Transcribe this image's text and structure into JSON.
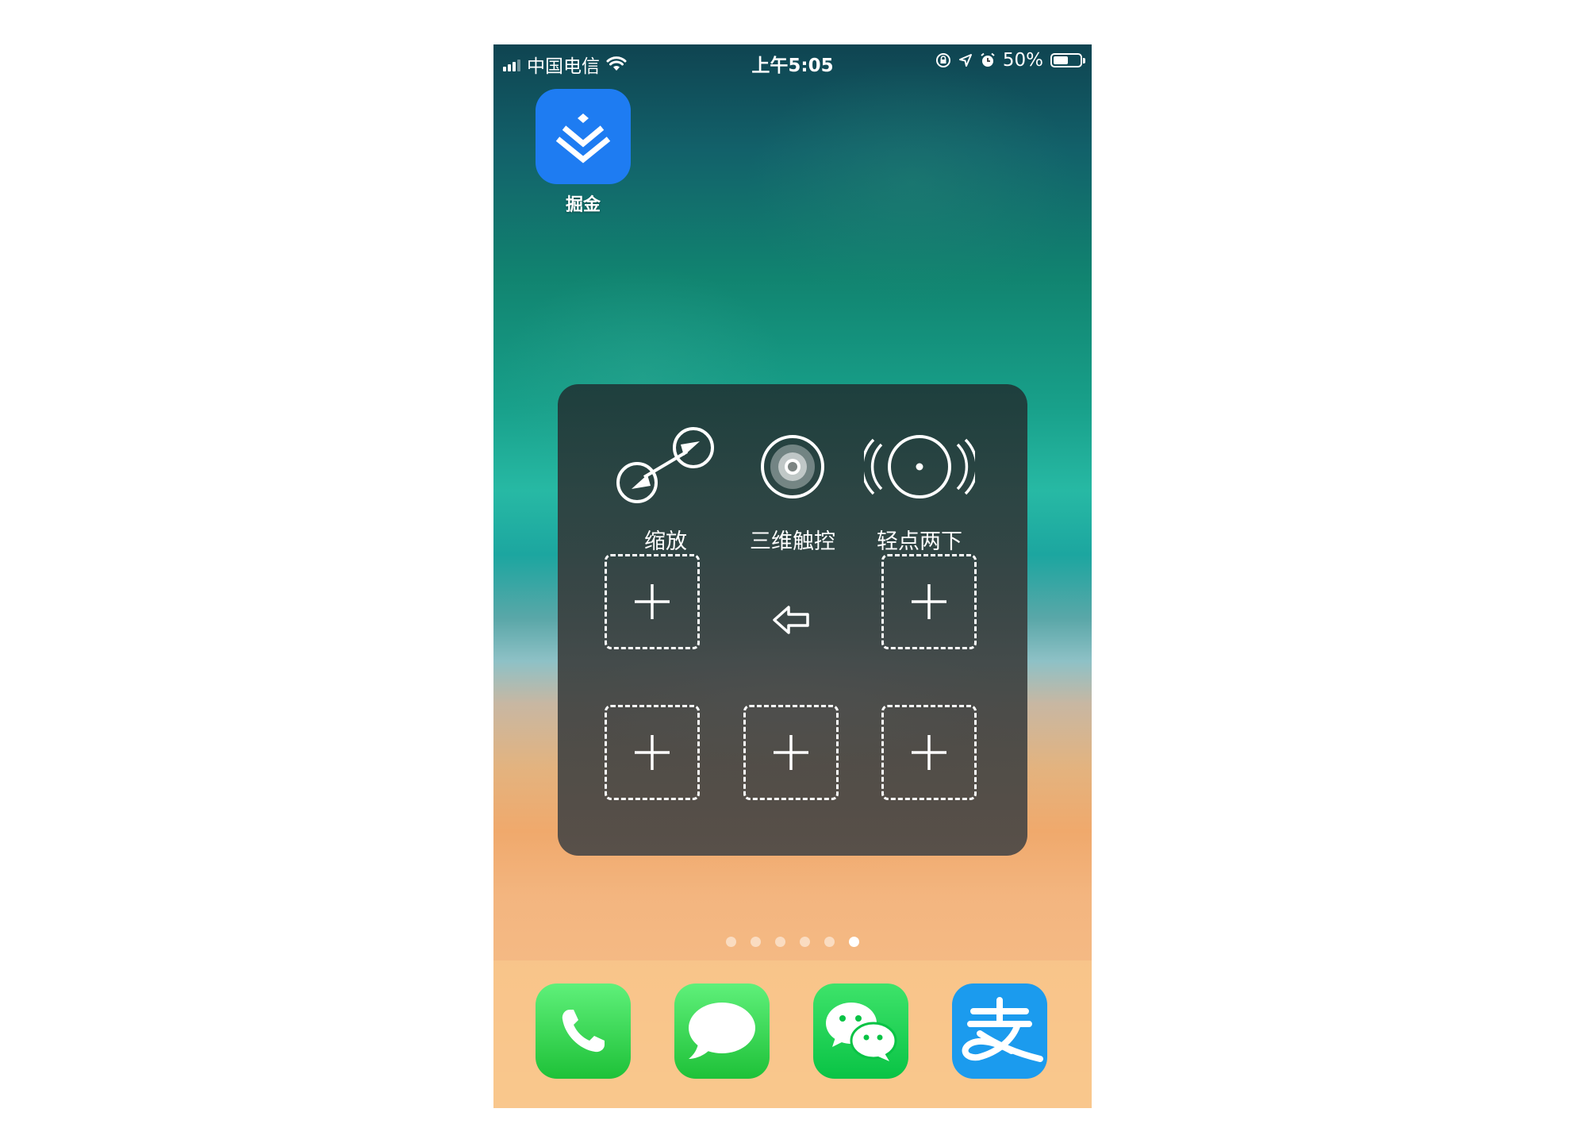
{
  "status_bar": {
    "carrier": "中国电信",
    "time": "上午5:05",
    "battery": "50%",
    "battery_level": 0.5
  },
  "home_apps": [
    {
      "label": "掘金",
      "icon": "juejin-icon"
    }
  ],
  "assistive_touch": {
    "items": [
      {
        "label": "缩放",
        "icon": "pinch-zoom-icon"
      },
      {
        "label": "三维触控",
        "icon": "3d-touch-icon"
      },
      {
        "label": "轻点两下",
        "icon": "double-tap-icon"
      }
    ],
    "empty_slot_icon": "plus-icon",
    "back_icon": "back-arrow-icon"
  },
  "page_dots": {
    "count": 6,
    "active_index": 5
  },
  "dock": [
    {
      "name": "Phone",
      "icon": "phone-icon",
      "color": "#2bd04a"
    },
    {
      "name": "Messages",
      "icon": "message-bubble-icon",
      "color": "#2bd04a"
    },
    {
      "name": "WeChat",
      "icon": "wechat-icon",
      "color": "#09c345"
    },
    {
      "name": "Alipay",
      "icon": "alipay-icon",
      "color": "#1b9bee"
    }
  ]
}
